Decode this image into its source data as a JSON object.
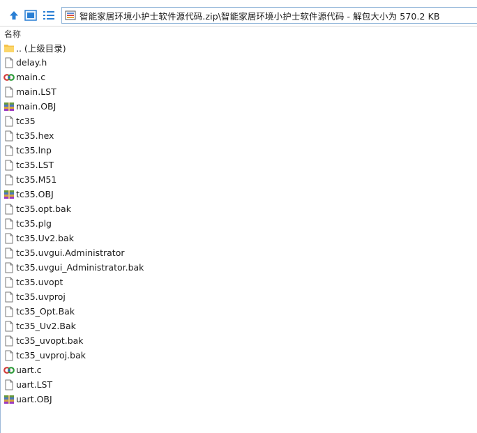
{
  "path": {
    "text": "智能家居环境小护士软件源代码.zip\\智能家居环境小护士软件源代码 - 解包大小为 570.2 KB"
  },
  "header": {
    "name_column": "名称"
  },
  "files": [
    {
      "name": ".. (上级目录)",
      "icon": "folder-icon"
    },
    {
      "name": "delay.h",
      "icon": "file-icon"
    },
    {
      "name": "main.c",
      "icon": "c-source-icon"
    },
    {
      "name": "main.LST",
      "icon": "file-icon"
    },
    {
      "name": "main.OBJ",
      "icon": "archive-icon"
    },
    {
      "name": "tc35",
      "icon": "file-icon"
    },
    {
      "name": "tc35.hex",
      "icon": "file-icon"
    },
    {
      "name": "tc35.lnp",
      "icon": "file-icon"
    },
    {
      "name": "tc35.LST",
      "icon": "file-icon"
    },
    {
      "name": "tc35.M51",
      "icon": "file-icon"
    },
    {
      "name": "tc35.OBJ",
      "icon": "archive-icon"
    },
    {
      "name": "tc35.opt.bak",
      "icon": "file-icon"
    },
    {
      "name": "tc35.plg",
      "icon": "file-icon"
    },
    {
      "name": "tc35.Uv2.bak",
      "icon": "file-icon"
    },
    {
      "name": "tc35.uvgui.Administrator",
      "icon": "file-icon"
    },
    {
      "name": "tc35.uvgui_Administrator.bak",
      "icon": "file-icon"
    },
    {
      "name": "tc35.uvopt",
      "icon": "file-icon"
    },
    {
      "name": "tc35.uvproj",
      "icon": "file-icon"
    },
    {
      "name": "tc35_Opt.Bak",
      "icon": "file-icon"
    },
    {
      "name": "tc35_Uv2.Bak",
      "icon": "file-icon"
    },
    {
      "name": "tc35_uvopt.bak",
      "icon": "file-icon"
    },
    {
      "name": "tc35_uvproj.bak",
      "icon": "file-icon"
    },
    {
      "name": "uart.c",
      "icon": "c-source-icon"
    },
    {
      "name": "uart.LST",
      "icon": "file-icon"
    },
    {
      "name": "uart.OBJ",
      "icon": "archive-icon"
    }
  ],
  "colors": {
    "accent": "#2a7fd4",
    "folder": "#f5c24a",
    "selection": "#e5f3ff"
  }
}
